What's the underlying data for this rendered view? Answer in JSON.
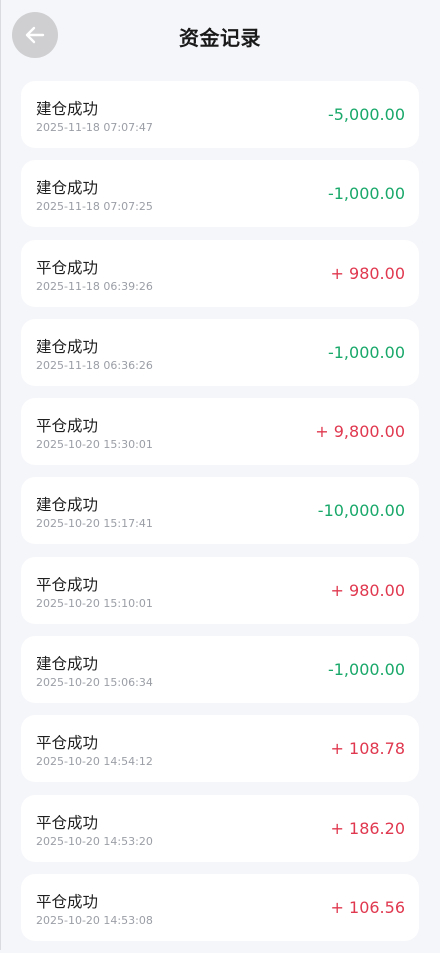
{
  "header": {
    "title": "资金记录"
  },
  "colors": {
    "positive": "#e0384f",
    "negative": "#19a86a",
    "background": "#f5f6fa"
  },
  "records": [
    {
      "title": "建仓成功",
      "time": "2025-11-18 07:07:47",
      "amount": "-5,000.00",
      "direction": "negative"
    },
    {
      "title": "建仓成功",
      "time": "2025-11-18 07:07:25",
      "amount": "-1,000.00",
      "direction": "negative"
    },
    {
      "title": "平仓成功",
      "time": "2025-11-18 06:39:26",
      "amount": "+ 980.00",
      "direction": "positive"
    },
    {
      "title": "建仓成功",
      "time": "2025-11-18 06:36:26",
      "amount": "-1,000.00",
      "direction": "negative"
    },
    {
      "title": "平仓成功",
      "time": "2025-10-20 15:30:01",
      "amount": "+ 9,800.00",
      "direction": "positive"
    },
    {
      "title": "建仓成功",
      "time": "2025-10-20 15:17:41",
      "amount": "-10,000.00",
      "direction": "negative"
    },
    {
      "title": "平仓成功",
      "time": "2025-10-20 15:10:01",
      "amount": "+ 980.00",
      "direction": "positive"
    },
    {
      "title": "建仓成功",
      "time": "2025-10-20 15:06:34",
      "amount": "-1,000.00",
      "direction": "negative"
    },
    {
      "title": "平仓成功",
      "time": "2025-10-20 14:54:12",
      "amount": "+ 108.78",
      "direction": "positive"
    },
    {
      "title": "平仓成功",
      "time": "2025-10-20 14:53:20",
      "amount": "+ 186.20",
      "direction": "positive"
    },
    {
      "title": "平仓成功",
      "time": "2025-10-20 14:53:08",
      "amount": "+ 106.56",
      "direction": "positive"
    }
  ]
}
